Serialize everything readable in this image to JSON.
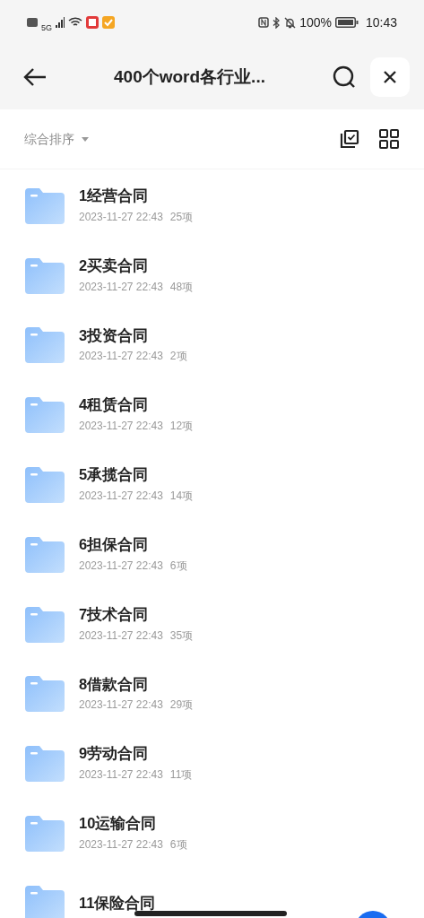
{
  "status_bar": {
    "network": "5G",
    "battery": "100%",
    "time": "10:43"
  },
  "header": {
    "title": "400个word各行业..."
  },
  "sort": {
    "label": "综合排序"
  },
  "folders": [
    {
      "name": "1经营合同",
      "date": "2023-11-27 22:43",
      "count": "25项"
    },
    {
      "name": "2买卖合同",
      "date": "2023-11-27 22:43",
      "count": "48项"
    },
    {
      "name": "3投资合同",
      "date": "2023-11-27 22:43",
      "count": "2项"
    },
    {
      "name": "4租赁合同",
      "date": "2023-11-27 22:43",
      "count": "12项"
    },
    {
      "name": "5承揽合同",
      "date": "2023-11-27 22:43",
      "count": "14项"
    },
    {
      "name": "6担保合同",
      "date": "2023-11-27 22:43",
      "count": "6项"
    },
    {
      "name": "7技术合同",
      "date": "2023-11-27 22:43",
      "count": "35项"
    },
    {
      "name": "8借款合同",
      "date": "2023-11-27 22:43",
      "count": "29项"
    },
    {
      "name": "9劳动合同",
      "date": "2023-11-27 22:43",
      "count": "11项"
    },
    {
      "name": "10运输合同",
      "date": "2023-11-27 22:43",
      "count": "6项"
    },
    {
      "name": "11保险合同"
    }
  ]
}
